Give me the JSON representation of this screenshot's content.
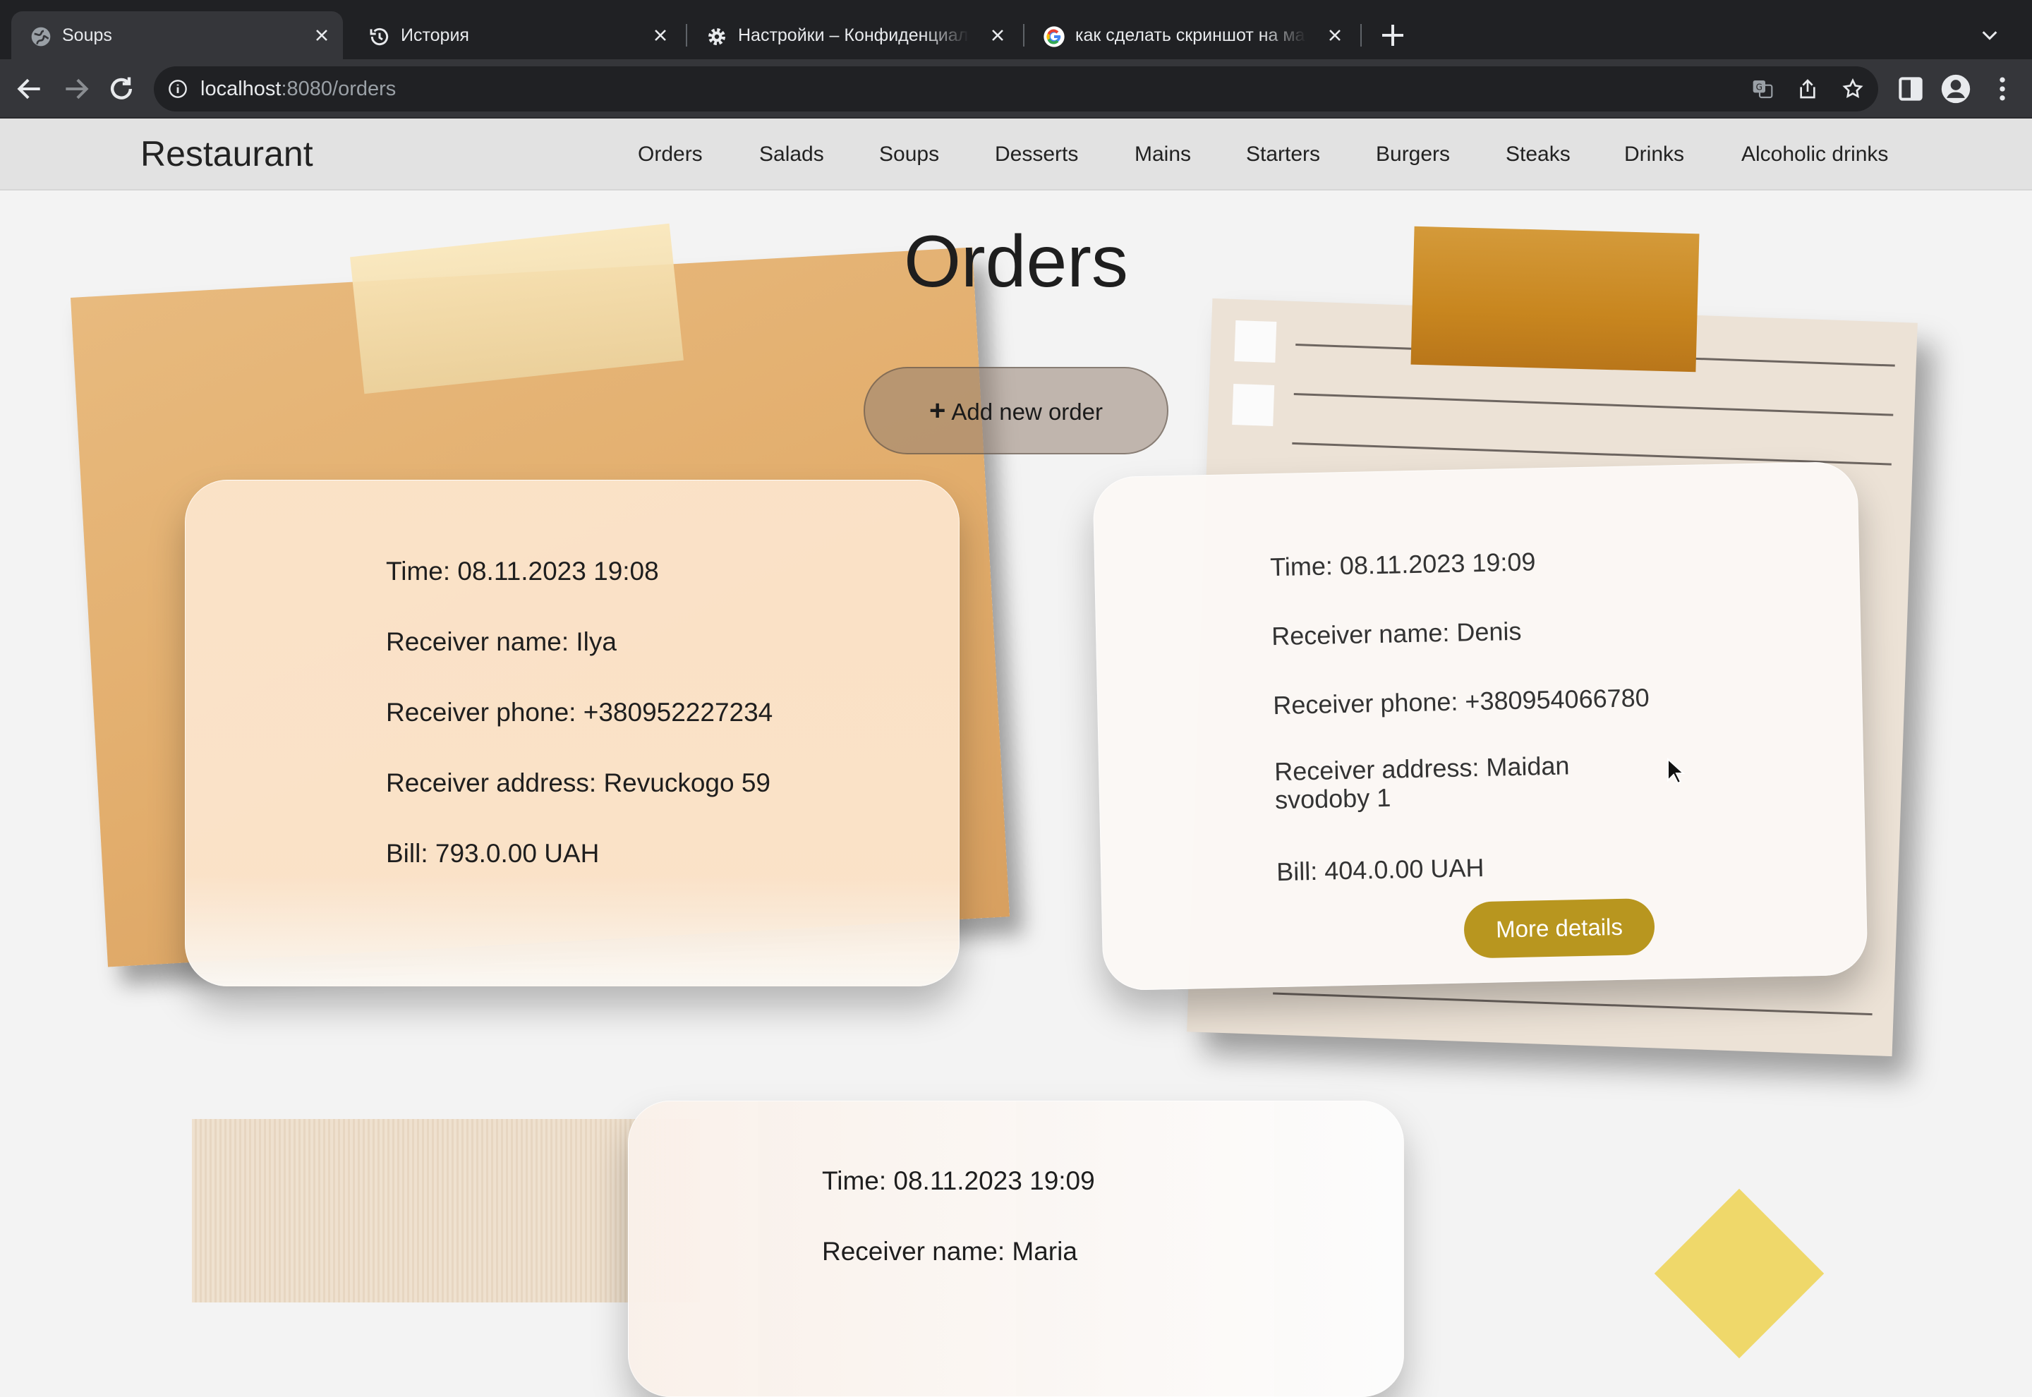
{
  "browser": {
    "tabs": [
      {
        "title": "Soups",
        "icon": "globe-icon",
        "active": true
      },
      {
        "title": "История",
        "icon": "history-icon",
        "active": false
      },
      {
        "title": "Настройки – Конфиденциальность",
        "icon": "gear-icon",
        "active": false
      },
      {
        "title": "как сделать скриншот на маке",
        "icon": "google-icon",
        "active": false
      }
    ],
    "url_host": "localhost",
    "url_path": ":8080/orders"
  },
  "navbar": {
    "brand": "Restaurant",
    "items": [
      "Orders",
      "Salads",
      "Soups",
      "Desserts",
      "Mains",
      "Starters",
      "Burgers",
      "Steaks",
      "Drinks",
      "Alcoholic drinks"
    ]
  },
  "page": {
    "title": "Orders",
    "add_button": "Add new order",
    "add_button_plus": "+"
  },
  "orders": [
    {
      "time": "Time: 08.11.2023 19:08",
      "name": "Receiver name: Ilya",
      "phone": "Receiver phone: +380952227234",
      "address": "Receiver address: Revuckogo 59",
      "bill": "Bill: 793.0.00 UAH"
    },
    {
      "time": "Time: 08.11.2023 19:09",
      "name": "Receiver name: Denis",
      "phone": "Receiver phone: +380954066780",
      "address": "Receiver address: Maidan svodoby 1",
      "bill": "Bill: 404.0.00 UAH",
      "details_button": "More details"
    },
    {
      "time": "Time: 08.11.2023 19:09",
      "name": "Receiver name: Maria"
    }
  ],
  "colors": {
    "browser_dark": "#202124",
    "browser_toolbar": "#35363a",
    "navbar_bg": "#e2e2e2",
    "details_button": "#b8961f"
  }
}
